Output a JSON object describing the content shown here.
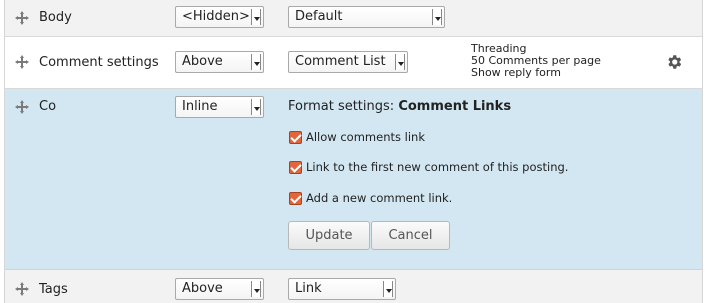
{
  "rows": {
    "body": {
      "label": "Body",
      "label_position": "<Hidden>",
      "formatter": "Default"
    },
    "comment": {
      "label": "Comment settings",
      "label_position": "Above",
      "formatter": "Comment List",
      "summary": [
        "Threading",
        "50 Comments per page",
        "Show reply form"
      ]
    },
    "co": {
      "label": "Co",
      "label_position": "Inline",
      "format_title_prefix": "Format settings:",
      "format_title_name": "Comment Links",
      "options": [
        {
          "label": "Allow comments link",
          "checked": true
        },
        {
          "label": "Link to the first new comment of this posting.",
          "checked": true
        },
        {
          "label": "Add a new comment link.",
          "checked": true
        }
      ],
      "update_label": "Update",
      "cancel_label": "Cancel"
    },
    "tags": {
      "label": "Tags",
      "label_position": "Above",
      "formatter": "Link"
    }
  },
  "icons": {
    "drag": "move-handle-icon",
    "settings": "gear-icon"
  },
  "colors": {
    "row_alt": "#f2f2f2",
    "row_active": "#d3e7f2",
    "checkbox": "#e2653b"
  }
}
